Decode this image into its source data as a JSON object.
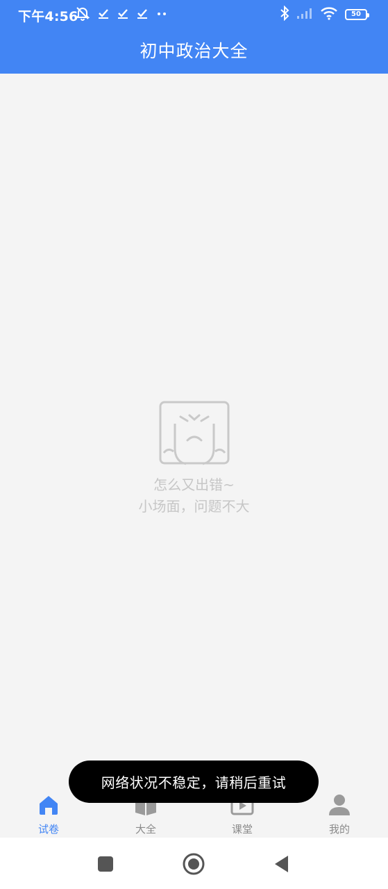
{
  "status_bar": {
    "time": "下午4:56",
    "battery_level": "50",
    "icons_left": [
      "muted-alarm-icon",
      "check-icon",
      "check-icon",
      "check-icon",
      "more-dots-icon"
    ],
    "icons_right": [
      "bluetooth-icon",
      "signal-icon",
      "wifi-icon",
      "battery-icon"
    ]
  },
  "header": {
    "title": "初中政治大全",
    "background_color": "#4285f4"
  },
  "error_state": {
    "illustration": "crying-face-icon",
    "line1": "怎么又出错~",
    "line2": "小场面，问题不大"
  },
  "toast": {
    "message": "网络状况不稳定，请稍后重试"
  },
  "tab_bar": {
    "active_color": "#4285f4",
    "inactive_color": "#8a8a8a",
    "tabs": [
      {
        "label": "试卷",
        "icon": "home-icon",
        "active": true
      },
      {
        "label": "大全",
        "icon": "book-icon",
        "active": false
      },
      {
        "label": "课堂",
        "icon": "video-icon",
        "active": false
      },
      {
        "label": "我的",
        "icon": "user-icon",
        "active": false
      }
    ]
  },
  "nav_bar": {
    "buttons": [
      "recents-button",
      "home-button",
      "back-button"
    ]
  }
}
